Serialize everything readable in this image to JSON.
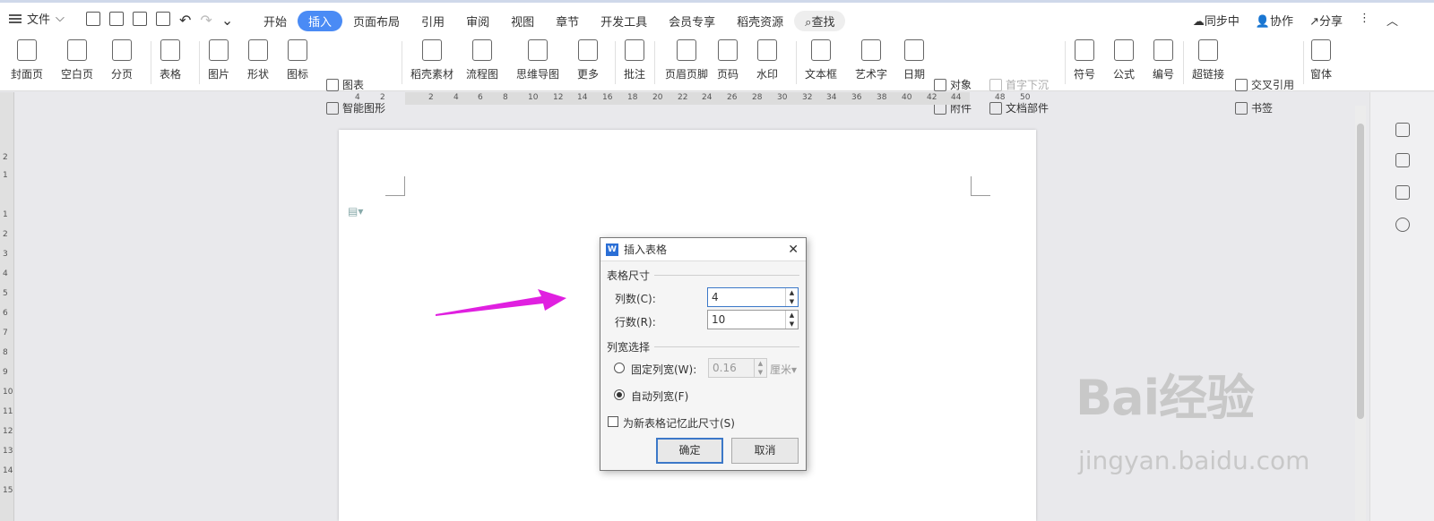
{
  "menubar": {
    "file": "文件",
    "tabs": [
      "开始",
      "插入",
      "页面布局",
      "引用",
      "审阅",
      "视图",
      "章节",
      "开发工具",
      "会员专享",
      "稻壳资源"
    ],
    "active_tab": "插入",
    "search": "查找",
    "sync": "同步中",
    "collab": "协作",
    "share": "分享"
  },
  "toolbar": {
    "cover": "封面页",
    "blank": "空白页",
    "pagebreak": "分页",
    "table": "表格",
    "picture": "图片",
    "shape": "形状",
    "iconlib": "图标",
    "chart": "图表",
    "smartart": "智能图形",
    "daoke": "稻壳素材",
    "flow": "流程图",
    "mindmap": "思维导图",
    "more": "更多",
    "comment": "批注",
    "headerfooter": "页眉页脚",
    "pagenum": "页码",
    "watermark": "水印",
    "textbox": "文本框",
    "wordart": "艺术字",
    "date": "日期",
    "object": "对象",
    "dropcap": "首字下沉",
    "attach": "附件",
    "docpart": "文档部件",
    "symbol": "符号",
    "formula": "公式",
    "numbering": "编号",
    "hyperlink": "超链接",
    "crossref": "交叉引用",
    "bookmark": "书签",
    "window": "窗体"
  },
  "ruler": [
    "4",
    "2",
    "2",
    "4",
    "6",
    "8",
    "10",
    "12",
    "14",
    "16",
    "18",
    "20",
    "22",
    "24",
    "26",
    "28",
    "30",
    "32",
    "34",
    "36",
    "38",
    "40",
    "42",
    "44",
    "48",
    "50"
  ],
  "vruler": [
    "2",
    "1",
    "1",
    "2",
    "3",
    "4",
    "5",
    "6",
    "7",
    "8",
    "9",
    "10",
    "11",
    "12",
    "13",
    "14",
    "15"
  ],
  "dialog": {
    "title": "插入表格",
    "size_group": "表格尺寸",
    "cols_label": "列数(C):",
    "cols_value": "4",
    "rows_label": "行数(R):",
    "rows_value": "10",
    "width_group": "列宽选择",
    "fixed_label": "固定列宽(W):",
    "fixed_value": "0.16",
    "unit": "厘米",
    "auto_label": "自动列宽(F)",
    "remember_label": "为新表格记忆此尺寸(S)",
    "ok": "确定",
    "cancel": "取消"
  },
  "watermark": {
    "brand": "Bai经验",
    "url": "jingyan.baidu.com"
  },
  "colors": {
    "accent": "#4a8bf5",
    "arrow": "#e020e0"
  }
}
